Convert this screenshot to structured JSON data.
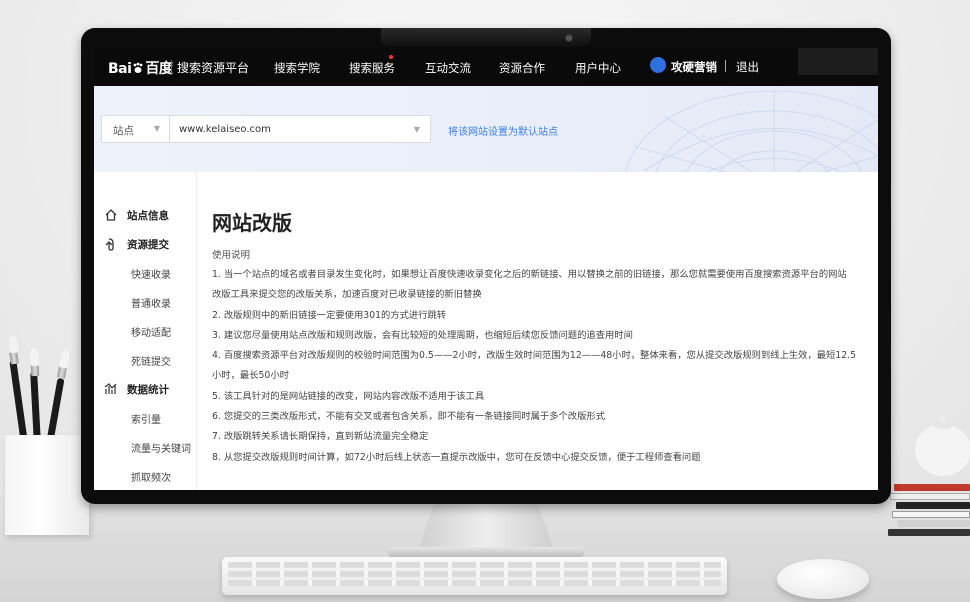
{
  "header": {
    "logo_text_left": "Bai",
    "logo_text_right": "百度",
    "platform_name": "搜索资源平台",
    "nav": [
      {
        "label": "搜索学院"
      },
      {
        "label": "搜索服务",
        "has_dot": true
      },
      {
        "label": "互动交流"
      },
      {
        "label": "资源合作"
      },
      {
        "label": "用户中心"
      }
    ],
    "user_name": "攻硬营销",
    "logout_label": "退出",
    "brand_color": "#2f6fe0"
  },
  "site_bar": {
    "site_label": "站点",
    "site_url": "www.kelaiseo.com",
    "set_default_label": "将该网站设置为默认站点",
    "link_color": "#3f7de4"
  },
  "sidebar": {
    "groups": [
      {
        "icon": "home-icon",
        "label": "站点信息",
        "items": []
      },
      {
        "icon": "submit-icon",
        "label": "资源提交",
        "items": [
          "快速收录",
          "普通收录",
          "移动适配",
          "死链提交"
        ]
      },
      {
        "icon": "stats-icon",
        "label": "数据统计",
        "items": [
          "索引量",
          "流量与关键词",
          "抓取频次"
        ]
      }
    ]
  },
  "main": {
    "title": "网站改版",
    "usage_label": "使用说明",
    "rules": [
      "1. 当一个站点的域名或者目录发生变化时，如果想让百度快速收录变化之后的新链接、用以替换之前的旧链接，那么您就需要使用百度搜索资源平台的网站",
      "改版工具来提交您的改版关系，加速百度对已收录链接的新旧替换",
      "2. 改版规则中的新旧链接一定要使用301的方式进行跳转",
      "3. 建议您尽量使用站点改版和规则改版，会有比较短的处理周期，也缩短后续您反馈问题的追查用时间",
      "4. 百度搜索资源平台对改版规则的校验时间范围为0.5——2小时，改版生效时间范围为12——48小时，整体来看，您从提交改版规则到线上生效，最短12.5",
      "小时，最长50小时",
      "5. 该工具针对的是网站链接的改变，网站内容改版不适用于该工具",
      "6. 您提交的三类改版形式，不能有交叉或者包含关系，即不能有一条链接同时属于多个改版形式",
      "7. 改版跳转关系请长期保持，直到新站流量完全稳定",
      "8. 从您提交改版规则时间计算，如72小时后线上状态一直提示改版中，您可在反馈中心提交反馈，便于工程师查看问题"
    ]
  }
}
